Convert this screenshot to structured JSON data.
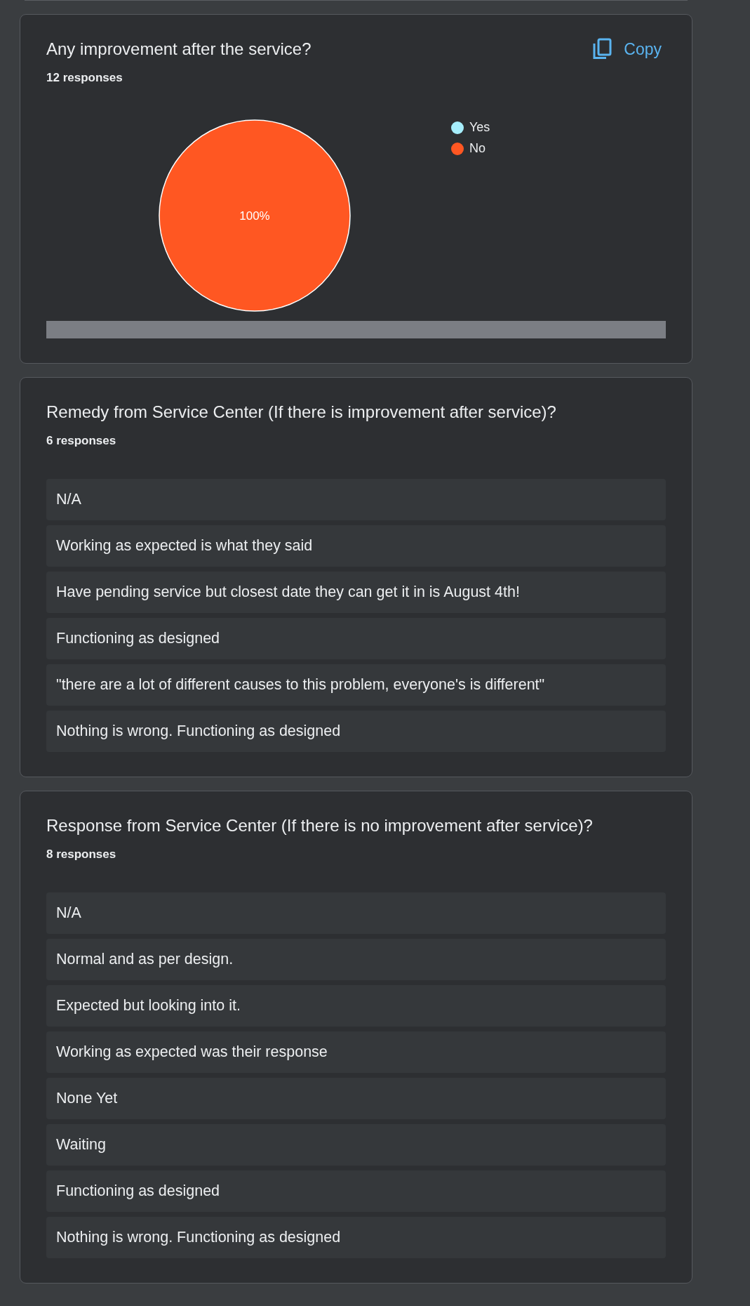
{
  "cards": [
    {
      "kind": "pie",
      "title": "Any improvement after the service?",
      "count": "12 responses",
      "copy_label": "Copy",
      "chart_data": {
        "type": "pie",
        "categories": [
          "Yes",
          "No"
        ],
        "values": [
          0,
          100
        ],
        "colors": [
          "#a6eefc",
          "#ff5722"
        ],
        "value_labels": [
          null,
          "100%"
        ]
      }
    },
    {
      "kind": "list",
      "title": "Remedy from Service Center (If there is improvement after service)?",
      "count": "6 responses",
      "responses": [
        "N/A",
        "Working as expected is what they said",
        "Have pending service but closest date they can get it in is August 4th!",
        "Functioning as designed",
        "\"there are a lot of different causes to this problem, everyone's is different\"",
        "Nothing is wrong. Functioning as designed"
      ]
    },
    {
      "kind": "list",
      "title": "Response from Service Center (If there is no improvement after service)?",
      "count": "8 responses",
      "responses": [
        "N/A",
        "Normal and as per design.",
        "Expected but looking into it.",
        "Working as expected was their response",
        "None Yet",
        "Waiting",
        "Functioning as designed",
        "Nothing is wrong. Functioning as designed"
      ]
    }
  ]
}
